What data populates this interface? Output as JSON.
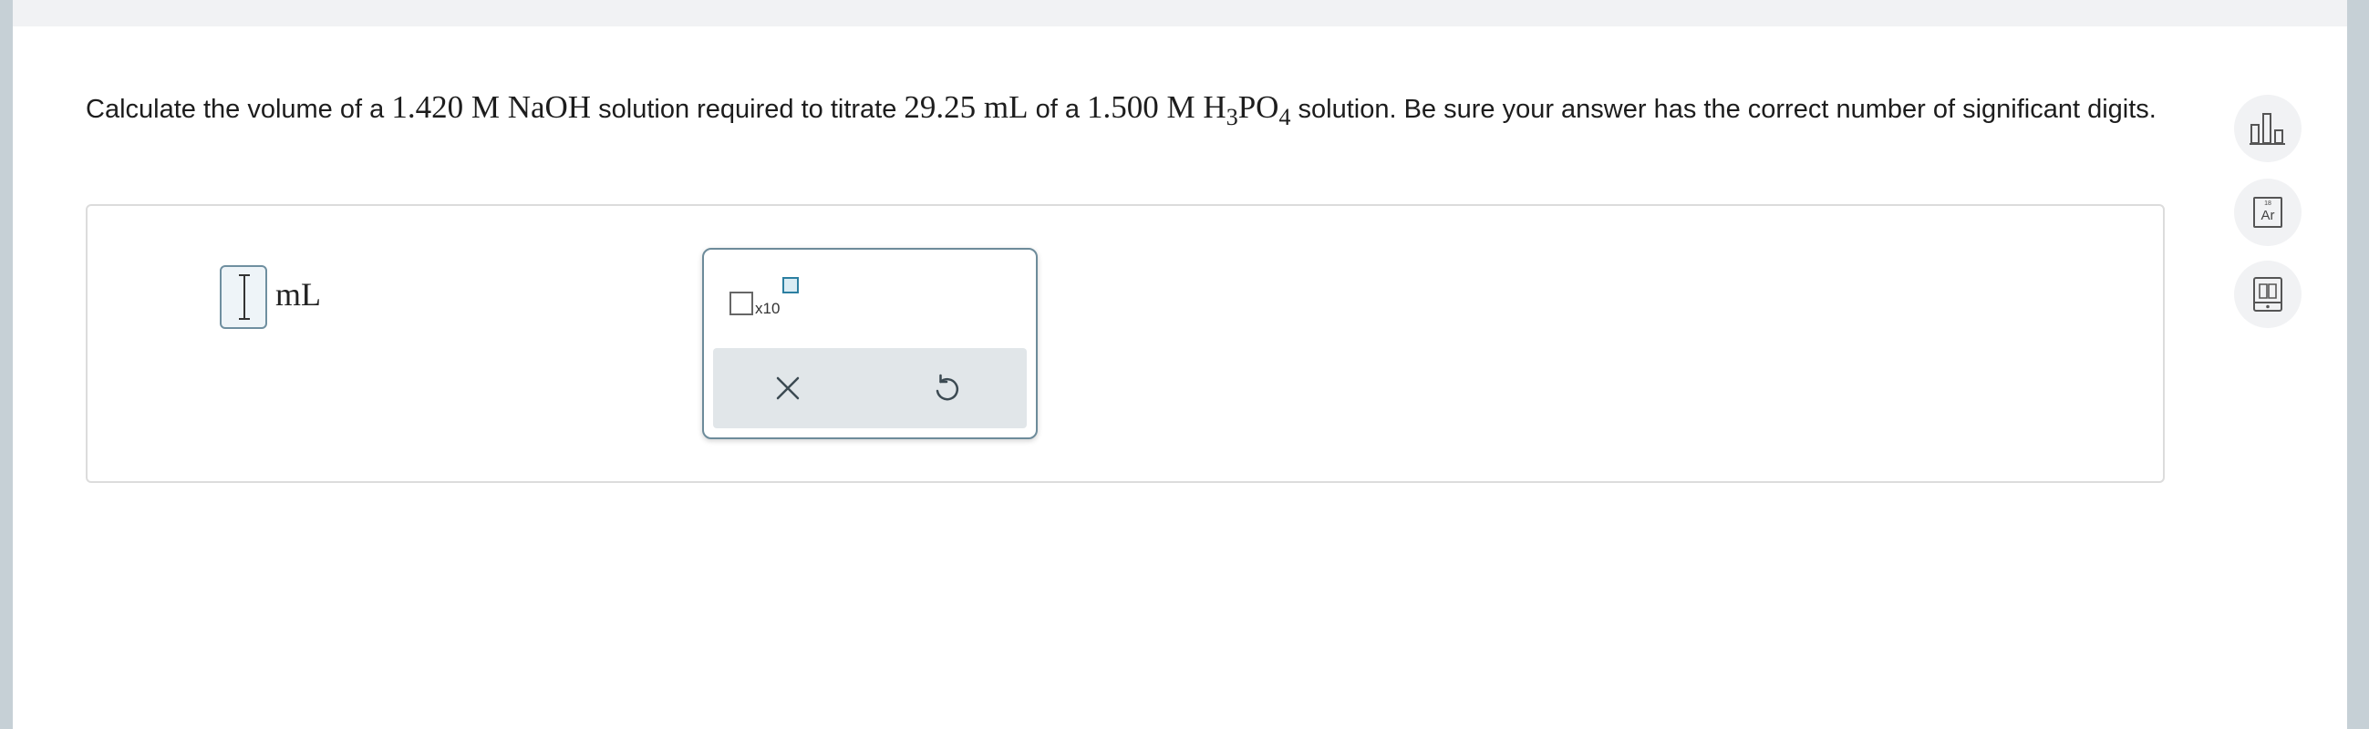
{
  "question": {
    "p1": "Calculate the volume of a ",
    "v1": "1.420",
    "u1": "M",
    "s1": "NaOH",
    "p2": " solution required to titrate ",
    "v2": "29.25",
    "u2": "mL",
    "p3": " of a ",
    "v3": "1.500",
    "u3": "M",
    "h": "H",
    "h_sub": "3",
    "po": "PO",
    "o_sub": "4",
    "p4": " solution. Be sure your answer has the correct number of significant digits."
  },
  "answer": {
    "value": "",
    "unit": "mL"
  },
  "tools": {
    "x10_label": "x10"
  },
  "icons": {
    "clear": "close-icon",
    "undo": "undo-icon",
    "data": "bar-chart-icon",
    "periodic": "periodic-table-icon",
    "reference": "book-icon"
  },
  "periodic_icon": {
    "number": "18",
    "symbol": "Ar"
  },
  "colors": {
    "rail": "#c6d0d6",
    "field_border": "#6f8fa0",
    "accent": "#2c7fa1",
    "panel_footer": "#e1e6e9"
  }
}
